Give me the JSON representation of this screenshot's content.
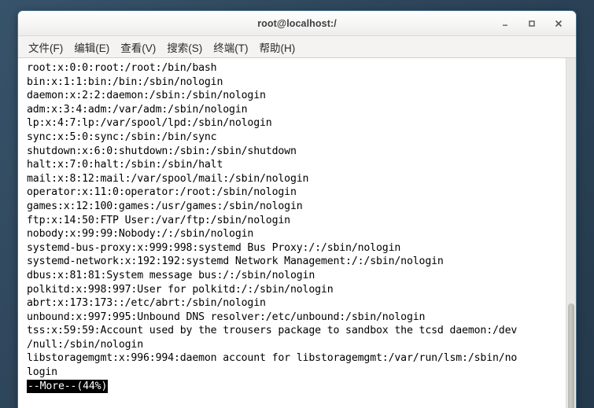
{
  "window": {
    "title": "root@localhost:/",
    "buttons": [
      {
        "name": "minimize-button",
        "label": "_"
      },
      {
        "name": "maximize-button",
        "label": "□"
      },
      {
        "name": "close-button",
        "label": "✕"
      }
    ]
  },
  "menubar": {
    "items": [
      {
        "label": "文件(F)"
      },
      {
        "label": "编辑(E)"
      },
      {
        "label": "查看(V)"
      },
      {
        "label": "搜索(S)"
      },
      {
        "label": "终端(T)"
      },
      {
        "label": "帮助(H)"
      }
    ]
  },
  "terminal": {
    "lines": [
      "root:x:0:0:root:/root:/bin/bash",
      "bin:x:1:1:bin:/bin:/sbin/nologin",
      "daemon:x:2:2:daemon:/sbin:/sbin/nologin",
      "adm:x:3:4:adm:/var/adm:/sbin/nologin",
      "lp:x:4:7:lp:/var/spool/lpd:/sbin/nologin",
      "sync:x:5:0:sync:/sbin:/bin/sync",
      "shutdown:x:6:0:shutdown:/sbin:/sbin/shutdown",
      "halt:x:7:0:halt:/sbin:/sbin/halt",
      "mail:x:8:12:mail:/var/spool/mail:/sbin/nologin",
      "operator:x:11:0:operator:/root:/sbin/nologin",
      "games:x:12:100:games:/usr/games:/sbin/nologin",
      "ftp:x:14:50:FTP User:/var/ftp:/sbin/nologin",
      "nobody:x:99:99:Nobody:/:/sbin/nologin",
      "systemd-bus-proxy:x:999:998:systemd Bus Proxy:/:/sbin/nologin",
      "systemd-network:x:192:192:systemd Network Management:/:/sbin/nologin",
      "dbus:x:81:81:System message bus:/:/sbin/nologin",
      "polkitd:x:998:997:User for polkitd:/:/sbin/nologin",
      "abrt:x:173:173::/etc/abrt:/sbin/nologin",
      "unbound:x:997:995:Unbound DNS resolver:/etc/unbound:/sbin/nologin",
      "tss:x:59:59:Account used by the trousers package to sandbox the tcsd daemon:/dev",
      "/null:/sbin/nologin",
      "libstoragemgmt:x:996:994:daemon account for libstoragemgmt:/var/run/lsm:/sbin/no",
      "login"
    ],
    "more_prompt": "--More--(44%)"
  },
  "colors": {
    "desktop": "#2d4459",
    "window_border": "#4a7390",
    "titlebar": "#f7f7f6",
    "terminal_bg": "#ffffff",
    "terminal_fg": "#000000",
    "prompt_bg": "#000000",
    "prompt_fg": "#ffffff"
  }
}
